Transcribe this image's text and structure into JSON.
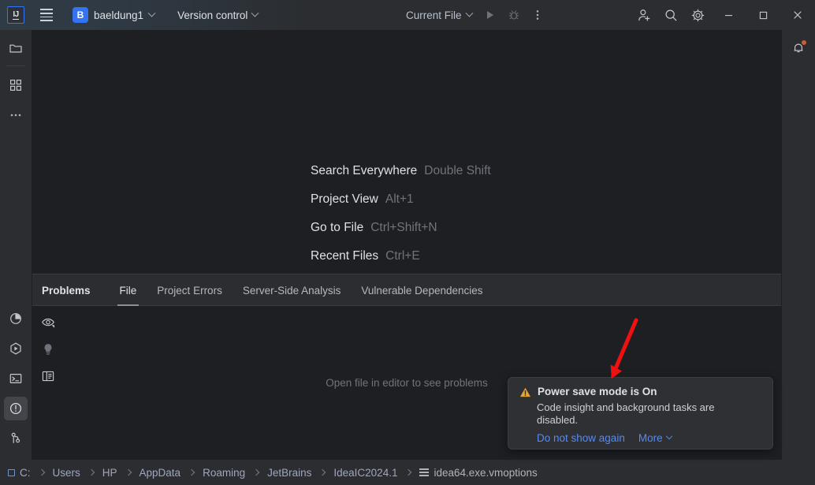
{
  "titlebar": {
    "logo": "ij-logo",
    "menu_icon": "hamburger-menu-icon",
    "project_badge": "B",
    "project_name": "baeldung1",
    "vcs_label": "Version control",
    "run_config": "Current File",
    "run_icon": "run-icon",
    "debug_icon": "debug-icon",
    "more_icon": "more-vertical-icon",
    "share_icon": "add-user-icon",
    "search_icon": "search-icon",
    "settings_icon": "gear-icon",
    "minimize": "minimize-icon",
    "maximize": "maximize-icon",
    "close": "close-icon"
  },
  "left_stripe": {
    "top_items": [
      {
        "name": "project-folder-icon",
        "tooltip": "Project"
      },
      {
        "name": "structure-grid-icon",
        "tooltip": "Structure"
      },
      {
        "name": "more-tool-windows-icon",
        "tooltip": "More"
      }
    ],
    "bottom_items": [
      {
        "name": "profiler-icon",
        "tooltip": "Profiler",
        "active": false
      },
      {
        "name": "services-run-icon",
        "tooltip": "Services",
        "active": false
      },
      {
        "name": "terminal-icon",
        "tooltip": "Terminal",
        "active": false
      },
      {
        "name": "problems-warning-icon",
        "tooltip": "Problems",
        "active": true
      },
      {
        "name": "git-branch-icon",
        "tooltip": "Version Control",
        "active": false
      }
    ]
  },
  "right_stripe": {
    "bell_icon": "notifications-bell-icon",
    "has_badge": true,
    "badge_color": "#cc5c32"
  },
  "editor": {
    "hints": [
      {
        "label": "Search Everywhere",
        "key": "Double Shift"
      },
      {
        "label": "Project View",
        "key": "Alt+1"
      },
      {
        "label": "Go to File",
        "key": "Ctrl+Shift+N"
      },
      {
        "label": "Recent Files",
        "key": "Ctrl+E"
      }
    ]
  },
  "problems_panel": {
    "title": "Problems",
    "tabs": [
      {
        "label": "File",
        "selected": true
      },
      {
        "label": "Project Errors",
        "selected": false
      },
      {
        "label": "Server-Side Analysis",
        "selected": false
      },
      {
        "label": "Vulnerable Dependencies",
        "selected": false
      }
    ],
    "toolbar": [
      {
        "name": "eye-visibility-icon"
      },
      {
        "name": "lightbulb-icon"
      },
      {
        "name": "preview-panel-icon"
      }
    ],
    "empty_message": "Open file in editor to see problems"
  },
  "notification": {
    "warning_icon": "warning-triangle-icon",
    "title": "Power save mode is On",
    "body": "Code insight and background tasks are disabled.",
    "link_dismiss": "Do not show again",
    "link_more": "More",
    "accent_color": "#548af7",
    "warning_color": "#e3a336"
  },
  "annotation": {
    "arrow_color": "#ee1111",
    "arrow_name": "red-pointer-arrow"
  },
  "statusbar": {
    "breadcrumb": [
      {
        "label": "C:",
        "icon": "drive-icon"
      },
      {
        "label": "Users",
        "icon": null
      },
      {
        "label": "HP",
        "icon": null
      },
      {
        "label": "AppData",
        "icon": null
      },
      {
        "label": "Roaming",
        "icon": null
      },
      {
        "label": "JetBrains",
        "icon": null
      },
      {
        "label": "IdeaIC2024.1",
        "icon": null
      },
      {
        "label": "idea64.exe.vmoptions",
        "icon": "file-lines-icon"
      }
    ]
  }
}
